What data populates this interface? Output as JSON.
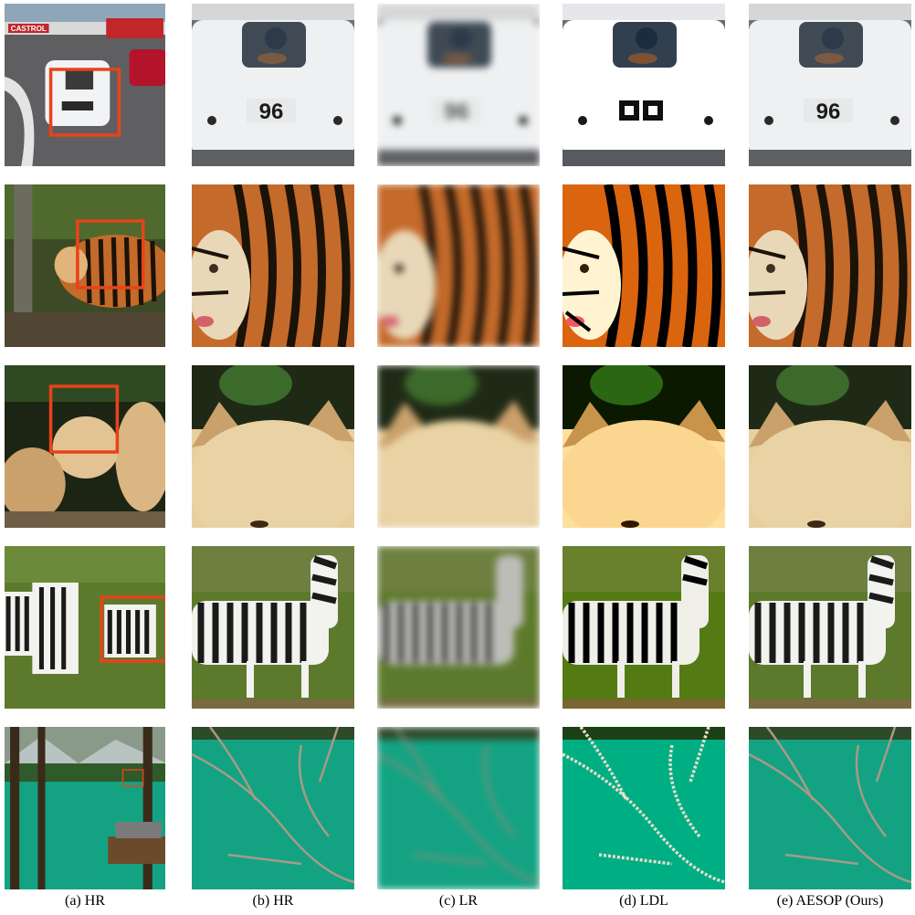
{
  "captions": {
    "a": "(a) HR",
    "b": "(b) HR",
    "c": "(c) LR",
    "d": "(d) LDL",
    "e": "(e) AESOP (Ours)"
  },
  "rows": [
    {
      "scene": "race-car",
      "plate_text": "96",
      "brand_text": "CASTROL",
      "brand_text2": "Castrol"
    },
    {
      "scene": "tiger"
    },
    {
      "scene": "fox-cubs"
    },
    {
      "scene": "zebras"
    },
    {
      "scene": "lake-branches"
    }
  ],
  "colors": {
    "highlight_box": "#e8431a",
    "water": "#13a383",
    "grass": "#5d7a2c",
    "tiger_orange": "#c46a2a"
  }
}
